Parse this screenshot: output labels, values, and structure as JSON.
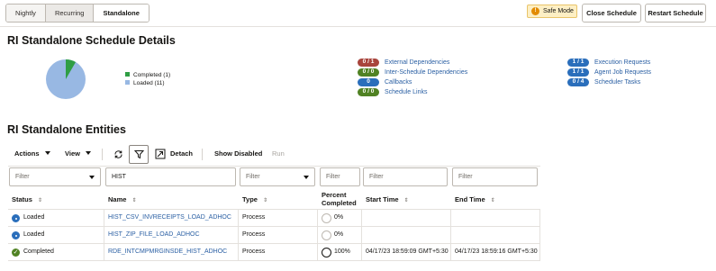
{
  "top": {
    "tabs": [
      "Nightly",
      "Recurring",
      "Standalone"
    ],
    "safe_mode": "Safe Mode",
    "close_schedule": "Close Schedule",
    "restart_schedule": "Restart Schedule"
  },
  "details": {
    "title": "RI Standalone Schedule Details",
    "legend": [
      {
        "label": "Completed (1)",
        "color": "#2f9e44",
        "count": 1
      },
      {
        "label": "Loaded (11)",
        "color": "#98b8e3",
        "count": 11
      }
    ],
    "dependencies": [
      {
        "badge": "0 / 1",
        "label": "External Dependencies",
        "color": "red"
      },
      {
        "badge": "0 / 0",
        "label": "Inter-Schedule Dependencies",
        "color": "green"
      },
      {
        "badge": "0",
        "label": "Callbacks",
        "color": "blue"
      },
      {
        "badge": "0 / 0",
        "label": "Schedule Links",
        "color": "green"
      }
    ],
    "requests": [
      {
        "badge": "1 / 1",
        "label": "Execution Requests",
        "color": "blue"
      },
      {
        "badge": "1 / 1",
        "label": "Agent Job Requests",
        "color": "blue"
      },
      {
        "badge": "0 / 4",
        "label": "Scheduler Tasks",
        "color": "blue"
      }
    ]
  },
  "entities": {
    "title": "RI Standalone Entities",
    "toolbar": {
      "actions": "Actions",
      "view": "View",
      "detach": "Detach",
      "show_disabled": "Show Disabled",
      "run": "Run"
    },
    "filters": {
      "status_placeholder": "Filter",
      "name_value": "HIST",
      "type_placeholder": "Filter",
      "percent_placeholder": "Filter",
      "start_placeholder": "Filter",
      "end_placeholder": "Filter"
    },
    "columns": {
      "status": "Status",
      "name": "Name",
      "type": "Type",
      "percent_line1": "Percent",
      "percent_line2": "Completed",
      "start": "Start Time",
      "end": "End Time"
    },
    "rows": [
      {
        "status": "Loaded",
        "name": "HIST_CSV_INVRECEIPTS_LOAD_ADHOC",
        "type": "Process",
        "percent": "0%",
        "start": "",
        "end": ""
      },
      {
        "status": "Loaded",
        "name": "HIST_ZIP_FILE_LOAD_ADHOC",
        "type": "Process",
        "percent": "0%",
        "start": "",
        "end": ""
      },
      {
        "status": "Completed",
        "name": "RDE_INTCMPMRGINSDE_HIST_ADHOC",
        "type": "Process",
        "percent": "100%",
        "start": "04/17/23 18:59:09 GMT+5:30",
        "end": "04/17/23 18:59:16 GMT+5:30"
      }
    ]
  }
}
